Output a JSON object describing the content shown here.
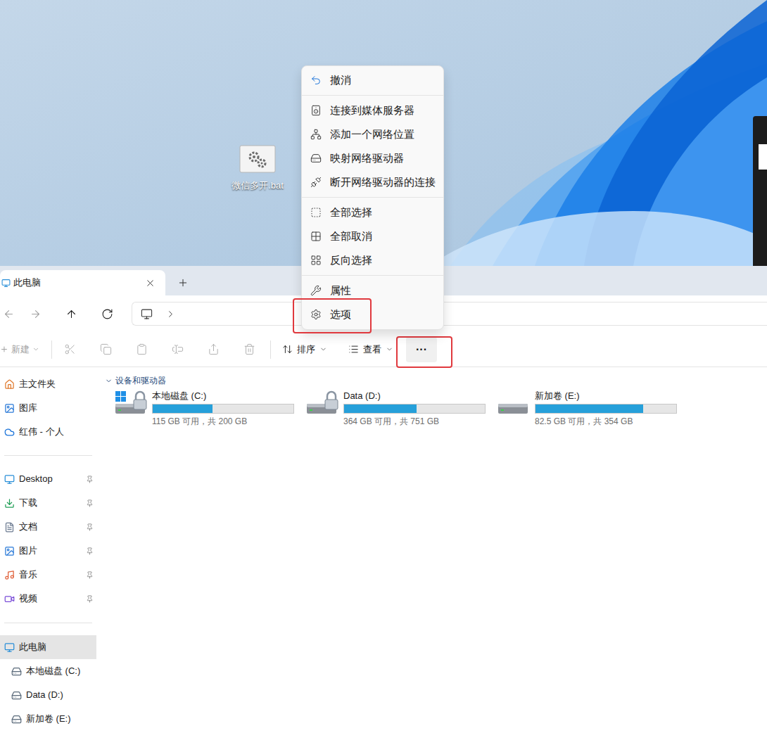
{
  "desktop": {
    "icons": [
      {
        "label": "微信多开.bat"
      }
    ]
  },
  "explorer": {
    "tabs": [
      {
        "label": "此电脑",
        "selected": true
      }
    ],
    "nav": {
      "back": {
        "disabled": true
      },
      "forward": {
        "disabled": true
      },
      "up": {
        "disabled": false
      },
      "refresh": {
        "disabled": false
      }
    },
    "toolbar": {
      "new": {
        "label": "新建",
        "disabled": true
      },
      "actions": [
        {
          "disabled": true
        },
        {
          "disabled": true
        },
        {
          "disabled": true
        },
        {
          "disabled": true
        },
        {
          "disabled": true
        },
        {
          "disabled": true
        }
      ],
      "sort": {
        "label": "排序"
      },
      "view": {
        "label": "查看"
      },
      "more": {
        "label": "···",
        "highlighted": true
      }
    },
    "sidebar": {
      "groups": [
        [
          {
            "label": "主文件夹",
            "pinned": false,
            "selected": false
          },
          {
            "label": "图库",
            "pinned": false,
            "selected": false
          },
          {
            "label": "红伟 - 个人",
            "pinned": false,
            "selected": false
          }
        ],
        [
          {
            "label": "Desktop",
            "pinned": true,
            "selected": false
          },
          {
            "label": "下载",
            "pinned": true,
            "selected": false
          },
          {
            "label": "文档",
            "pinned": true,
            "selected": false
          },
          {
            "label": "图片",
            "pinned": true,
            "selected": false
          },
          {
            "label": "音乐",
            "pinned": true,
            "selected": false
          },
          {
            "label": "视频",
            "pinned": true,
            "selected": false
          }
        ],
        [
          {
            "label": "此电脑",
            "pinned": false,
            "selected": true
          },
          {
            "label": "本地磁盘 (C:)",
            "pinned": false,
            "selected": false
          },
          {
            "label": "Data (D:)",
            "pinned": false,
            "selected": false
          },
          {
            "label": "新加卷 (E:)",
            "pinned": false,
            "selected": false
          }
        ]
      ]
    },
    "section": {
      "title": "设备和驱动器",
      "expanded": true
    },
    "drives": [
      {
        "name": "本地磁盘 (C:)",
        "free": "115 GB 可用，共 200 GB",
        "level": 0.425,
        "system": true,
        "locked": true
      },
      {
        "name": "Data (D:)",
        "free": "364 GB 可用，共 751 GB",
        "level": 0.515,
        "system": false,
        "locked": true
      },
      {
        "name": "新加卷 (E:)",
        "free": "82.5 GB 可用，共 354 GB",
        "level": 0.767,
        "system": false,
        "locked": false
      }
    ]
  },
  "context_menu": {
    "groups": [
      [
        {
          "label": "撤消",
          "highlighted": false
        }
      ],
      [
        {
          "label": "连接到媒体服务器",
          "highlighted": false
        },
        {
          "label": "添加一个网络位置",
          "highlighted": false
        },
        {
          "label": "映射网络驱动器",
          "highlighted": false
        },
        {
          "label": "断开网络驱动器的连接",
          "highlighted": false
        }
      ],
      [
        {
          "label": "全部选择",
          "highlighted": false
        },
        {
          "label": "全部取消",
          "highlighted": false
        },
        {
          "label": "反向选择",
          "highlighted": false
        }
      ],
      [
        {
          "label": "属性",
          "highlighted": false
        },
        {
          "label": "选项",
          "highlighted": true
        }
      ]
    ]
  }
}
